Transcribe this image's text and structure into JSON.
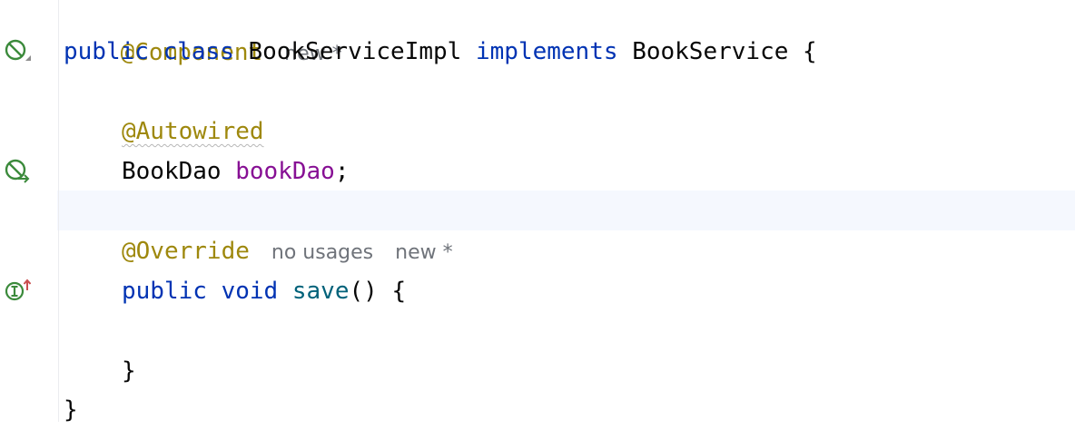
{
  "editor": {
    "line1": {
      "annotation": "@Component",
      "hint_new": "new *"
    },
    "line2": {
      "kw_public": "public",
      "kw_class": "class",
      "class_name": "BookServiceImpl",
      "kw_implements": "implements",
      "interface_name": "BookService",
      "brace": "{"
    },
    "line4": {
      "annotation": "@Autowired"
    },
    "line5": {
      "type": "BookDao",
      "field": "bookDao",
      "semi": ";"
    },
    "line7": {
      "annotation": "@Override",
      "hint_usages": "no usages",
      "hint_new": "new *"
    },
    "line8": {
      "kw_public": "public",
      "kw_void": "void",
      "method": "save",
      "parens": "()",
      "brace": "{"
    },
    "line10": {
      "brace": "}"
    },
    "line11": {
      "brace": "}"
    }
  },
  "colors": {
    "annotation": "#9e880d",
    "keyword": "#0033b3",
    "field": "#871094",
    "method": "#00627a",
    "hint": "#6f737a",
    "gutter_icon": "#3b8a3b",
    "override_arrow": "#c94f4f",
    "current_line": "#f5f8fe"
  },
  "gutter_icons": [
    "spring-bean-icon",
    "spring-autowired-icon",
    "implements-method-icon"
  ]
}
